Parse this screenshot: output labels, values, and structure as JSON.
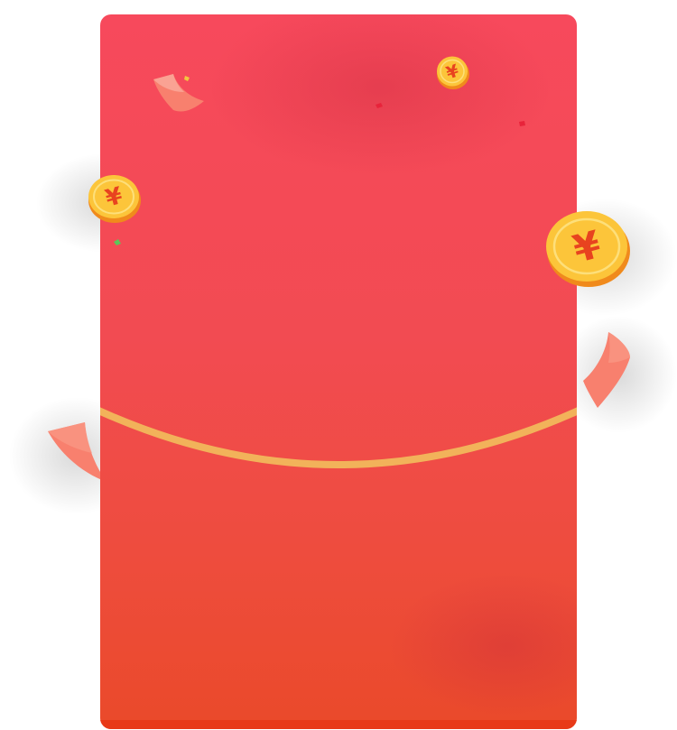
{
  "envelope": {
    "colors": {
      "top": "#f7495c",
      "bottom": "#ea4a2a",
      "bottom_edge": "#e83a18",
      "arc": "#f2b25a"
    }
  },
  "coins": {
    "symbol": "¥",
    "colors": {
      "face": "#fcc53a",
      "rim": "#f08a1c",
      "symbol": "#e8431f"
    }
  },
  "ribbons": {
    "color": "#f8806e"
  },
  "confetti": {
    "colors": [
      "#e8233a",
      "#5fc45a",
      "#f3c640"
    ]
  }
}
